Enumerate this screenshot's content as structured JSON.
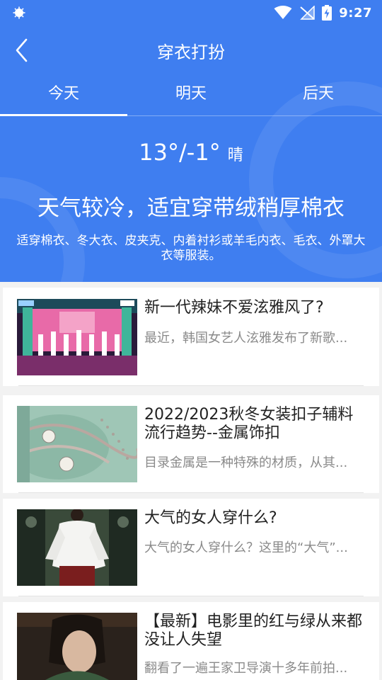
{
  "status": {
    "time": "9:27"
  },
  "header": {
    "title": "穿衣打扮"
  },
  "tabs": [
    {
      "label": "今天"
    },
    {
      "label": "明天"
    },
    {
      "label": "后天"
    }
  ],
  "weather": {
    "temperature": "13°/-1°",
    "condition": "晴",
    "headline": "天气较冷，适宜穿带绒稍厚棉衣",
    "advice": "适穿棉衣、冬大衣、皮夹克、内着衬衫或羊毛内衣、毛衣、外罩大衣等服装。"
  },
  "articles": [
    {
      "title": "新一代辣妹不爱泫雅风了?",
      "summary": "最近，韩国女艺人泫雅发布了新歌..."
    },
    {
      "title": "2022/2023秋冬女装扣子辅料流行趋势--金属饰扣",
      "summary": "目录金属是一种特殊的材质，从其..."
    },
    {
      "title": "大气的女人穿什么?",
      "summary": "大气的女人穿什么？这里的“大气”..."
    },
    {
      "title": "【最新】电影里的红与绿从来都没让人失望",
      "summary": "翻看了一遍王家卫导演十多年前拍..."
    }
  ],
  "colors": {
    "primary": "#3f7ef0",
    "background": "#f2f2f2"
  }
}
